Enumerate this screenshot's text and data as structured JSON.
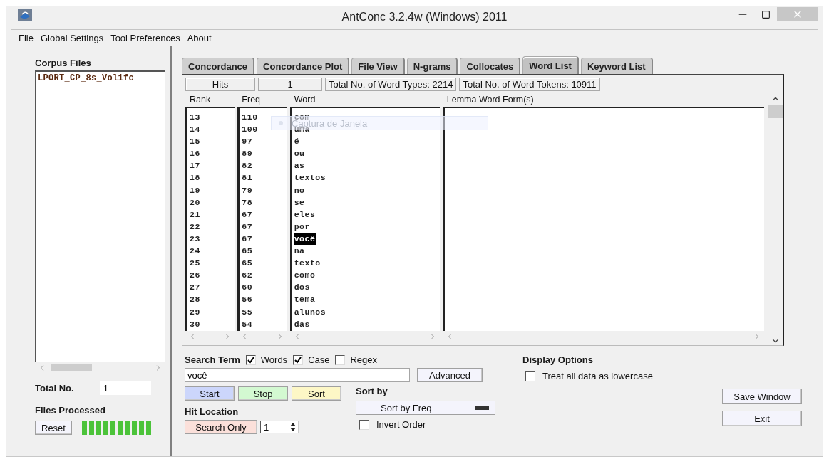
{
  "window": {
    "title": "AntConc 3.2.4w (Windows) 2011"
  },
  "menu": [
    "File",
    "Global Settings",
    "Tool Preferences",
    "About"
  ],
  "corpus": {
    "label": "Corpus Files",
    "files": [
      "LPORT_CP_8s_Vol1fc"
    ],
    "total_label": "Total No.",
    "total": "1",
    "processed_label": "Files Processed",
    "reset": "Reset"
  },
  "tabs": [
    {
      "label": "Concordance",
      "selected": false
    },
    {
      "label": "Concordance Plot",
      "selected": false
    },
    {
      "label": "File View",
      "selected": false
    },
    {
      "label": "N-grams",
      "selected": false
    },
    {
      "label": "Collocates",
      "selected": false
    },
    {
      "label": "Word List",
      "selected": true
    },
    {
      "label": "Keyword List",
      "selected": false
    }
  ],
  "stats": {
    "hits_label": "Hits",
    "hits": "1",
    "types": "Total No. of Word Types: 2214",
    "tokens": "Total No. of Word Tokens: 10911"
  },
  "table": {
    "columns": [
      "Rank",
      "Freq",
      "Word",
      "Lemma Word Form(s)"
    ],
    "rows": [
      {
        "rank": "13",
        "freq": "110",
        "word": "com",
        "selected": false
      },
      {
        "rank": "14",
        "freq": "100",
        "word": "uma",
        "selected": false
      },
      {
        "rank": "15",
        "freq": "97",
        "word": "é",
        "selected": false
      },
      {
        "rank": "16",
        "freq": "89",
        "word": "ou",
        "selected": false
      },
      {
        "rank": "17",
        "freq": "82",
        "word": "as",
        "selected": false
      },
      {
        "rank": "18",
        "freq": "81",
        "word": "textos",
        "selected": false
      },
      {
        "rank": "19",
        "freq": "79",
        "word": "no",
        "selected": false
      },
      {
        "rank": "20",
        "freq": "78",
        "word": "se",
        "selected": false
      },
      {
        "rank": "21",
        "freq": "67",
        "word": "eles",
        "selected": false
      },
      {
        "rank": "22",
        "freq": "67",
        "word": "por",
        "selected": false
      },
      {
        "rank": "23",
        "freq": "67",
        "word": "você",
        "selected": true
      },
      {
        "rank": "24",
        "freq": "65",
        "word": "na",
        "selected": false
      },
      {
        "rank": "25",
        "freq": "65",
        "word": "texto",
        "selected": false
      },
      {
        "rank": "26",
        "freq": "62",
        "word": "como",
        "selected": false
      },
      {
        "rank": "27",
        "freq": "60",
        "word": "dos",
        "selected": false
      },
      {
        "rank": "28",
        "freq": "56",
        "word": "tema",
        "selected": false
      },
      {
        "rank": "29",
        "freq": "55",
        "word": "alunos",
        "selected": false
      },
      {
        "rank": "30",
        "freq": "54",
        "word": "das",
        "selected": false
      }
    ]
  },
  "overlay": {
    "label": "Captura de Janela"
  },
  "search": {
    "label": "Search Term",
    "options": [
      {
        "label": "Words",
        "checked": true
      },
      {
        "label": "Case",
        "checked": true
      },
      {
        "label": "Regex",
        "checked": false
      }
    ],
    "value": "você",
    "advanced": "Advanced",
    "buttons": [
      {
        "label": "Start",
        "color": "#ccd6fb"
      },
      {
        "label": "Stop",
        "color": "#d3f9d1"
      },
      {
        "label": "Sort",
        "color": "#fdf7c6"
      }
    ]
  },
  "hit_location": {
    "label": "Hit Location",
    "button": "Search Only",
    "value": "1"
  },
  "sort": {
    "label": "Sort by",
    "value": "Sort by Freq",
    "invert": {
      "label": "Invert Order",
      "checked": false
    }
  },
  "display": {
    "label": "Display Options",
    "lowercase": {
      "label": "Treat all data as lowercase",
      "checked": false
    }
  },
  "actions": [
    "Save Window",
    "Exit"
  ]
}
